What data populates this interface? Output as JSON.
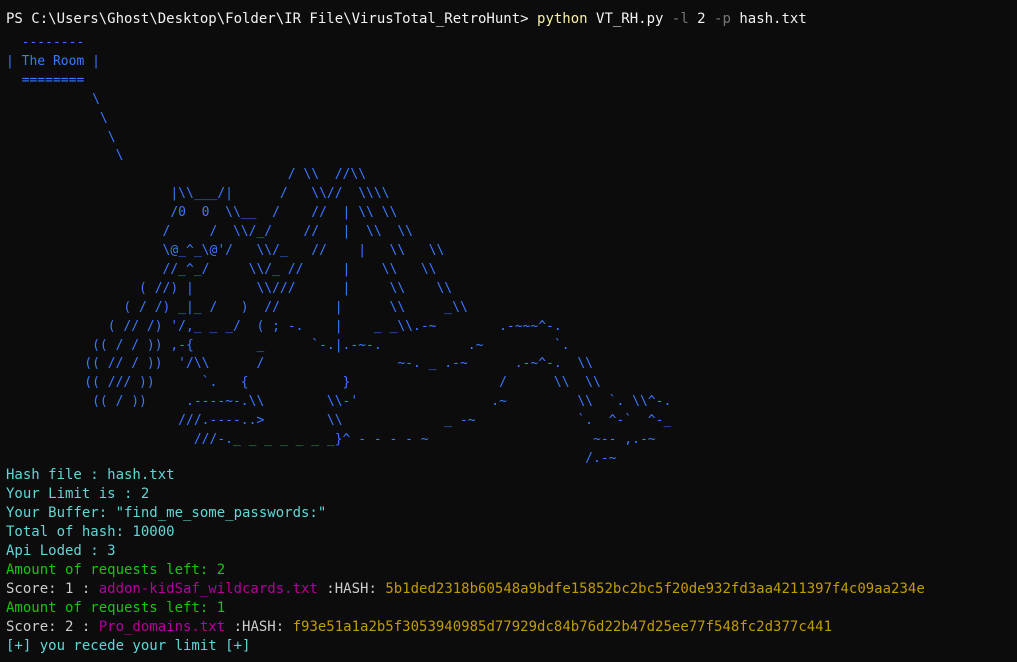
{
  "prompt": {
    "path": "PS C:\\Users\\Ghost\\Desktop\\Folder\\IR File\\VirusTotal_RetroHunt> ",
    "command": "python",
    "script": " VT_RH.py ",
    "flag_l": "-l",
    "limit_value": " 2 ",
    "flag_p": "-p",
    "hash_file": " hash.txt"
  },
  "ascii_art": "  --------\n| The Room |\n  ========\n           \\\n            \\\n             \\\n              \\\n                                    / \\\\  //\\\\\n                     |\\\\___/|      /   \\\\//  \\\\\\\\\n                     /0  0  \\\\__  /    //  | \\\\ \\\\\n                    /     /  \\\\/_/    //   |  \\\\  \\\\\n                    \\@_^_\\@'/   \\\\/_   //    |   \\\\   \\\\\n                    //_^_/     \\\\/_ //     |    \\\\   \\\\\n                 ( //) |        \\\\///      |     \\\\    \\\\\n               ( / /) _|_ /   )  //       |      \\\\     _\\\\\n             ( // /) '/,_ _ _/  ( ; -.    |    _ _\\\\.-~        .-~~~^-.\n           (( / / )) ,-{        _      `-.|.-~-.           .~         `.\n          (( // / ))  '/\\\\      /                 ~-. _ .-~      .-~^-.  \\\\\n          (( /// ))      `.   {            }                   /      \\\\  \\\\\n           (( / ))     .----~-.\\\\        \\\\-'                 .~         \\\\  `. \\\\^-.\n                      ///.----..>        \\\\             _ -~             `.  ^-`  ^-_\n                        ///-._ _ _ _ _ _ _}^ - - - - ~                     ~-- ,.-~\n                                                                          /.-~",
  "output": {
    "hash_file": "Hash file : hash.txt",
    "limit": "Your Limit is : 2",
    "buffer": "Your Buffer: \"find_me_some_passwords:\"",
    "total": "Total of hash: 10000",
    "api": "Api Loded : 3",
    "requests_left_1": "Amount of requests left: 2",
    "score1_prefix": "Score: 1 : ",
    "score1_file": "addon-kidSaf_wildcards.txt",
    "score1_hash_label": " :HASH: ",
    "score1_hash": "5b1ded2318b60548a9bdfe15852bc2bc5f20de932fd3aa4211397f4c09aa234e",
    "requests_left_2": "Amount of requests left: 1",
    "score2_prefix": "Score: 2 : ",
    "score2_file": "Pro_domains.txt",
    "score2_hash_label": " :HASH: ",
    "score2_hash": "f93e51a1a2b5f3053940985d77929dc84b76d22b47d25ee77f548fc2d377c441",
    "recede": "[+] you recede your limit [+]"
  },
  "colors": {
    "background": "#0c0c0c",
    "art": "#3b78ff",
    "info": "#61d6d6",
    "green": "#16c60c",
    "magenta": "#b4009e",
    "hash": "#c19c00",
    "command": "#f9f1a5"
  }
}
